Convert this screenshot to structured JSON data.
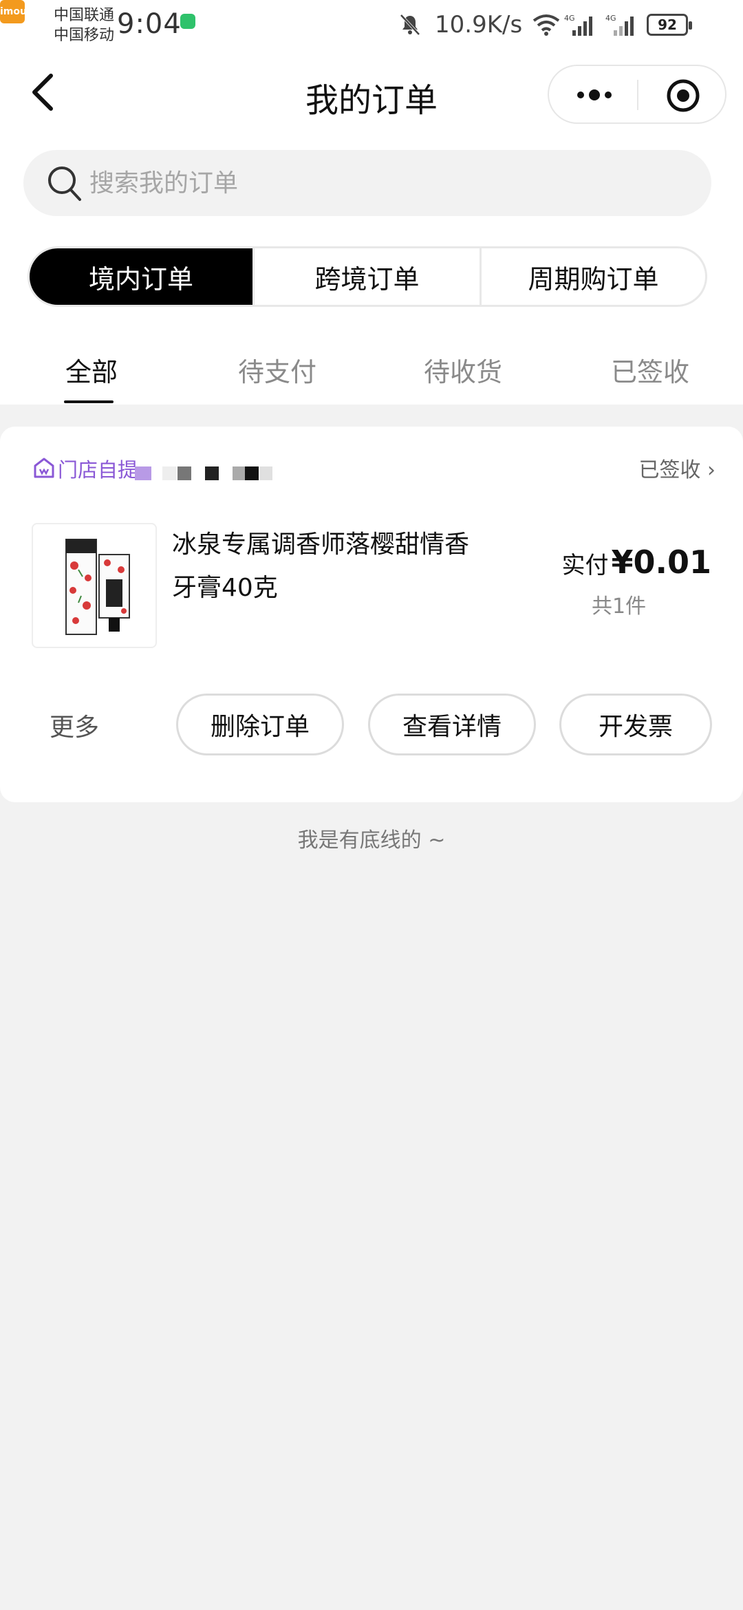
{
  "status_bar": {
    "carrier_1": "中国联通",
    "carrier_2": "中国移动",
    "time": "9:04",
    "app_badge": "imou",
    "net_speed": "10.9K/s",
    "signal_1_label": "4G",
    "signal_2_label": "4G",
    "battery": "92"
  },
  "header": {
    "title": "我的订单"
  },
  "search": {
    "placeholder": "搜索我的订单"
  },
  "segments": [
    {
      "label": "境内订单",
      "active": true
    },
    {
      "label": "跨境订单",
      "active": false
    },
    {
      "label": "周期购订单",
      "active": false
    }
  ],
  "tabs": [
    {
      "label": "全部",
      "active": true
    },
    {
      "label": "待支付",
      "active": false
    },
    {
      "label": "待收货",
      "active": false
    },
    {
      "label": "已签收",
      "active": false
    }
  ],
  "order": {
    "store_label": "门店自提",
    "status": "已签收",
    "product_name": "冰泉专属调香师落樱甜情香牙膏40克",
    "price_prefix": "实付",
    "price": "¥0.01",
    "count": "共1件",
    "more_label": "更多",
    "actions": [
      {
        "label": "删除订单"
      },
      {
        "label": "查看详情"
      },
      {
        "label": "开发票"
      }
    ]
  },
  "footer_text": "我是有底线的 ~",
  "colors": {
    "accent_purple": "#8a58d6",
    "active_segment": "#000000",
    "page_bg": "#f2f2f2"
  }
}
